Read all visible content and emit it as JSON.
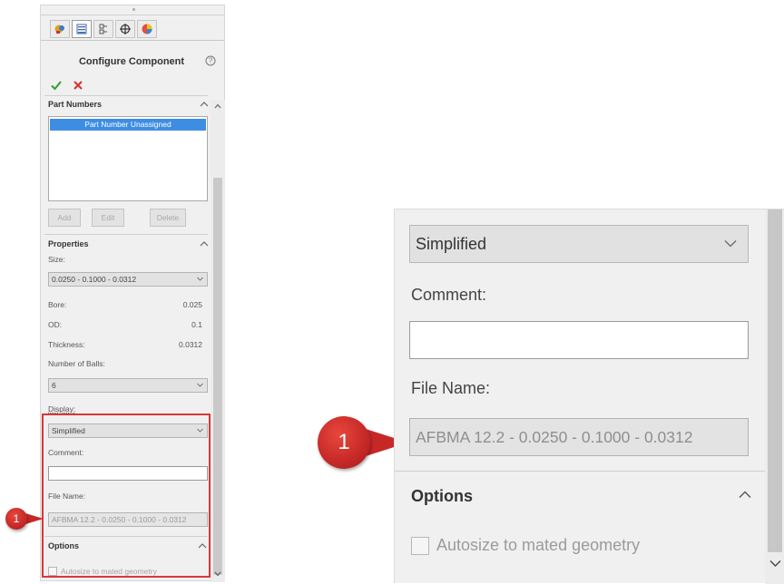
{
  "left_panel": {
    "tabs": [
      {
        "name": "feature-manager-tab",
        "icon": "feature-manager-icon"
      },
      {
        "name": "property-manager-tab",
        "icon": "property-manager-icon"
      },
      {
        "name": "configuration-manager-tab",
        "icon": "configuration-manager-icon"
      },
      {
        "name": "dimxpert-manager-tab",
        "icon": "crosshair-icon"
      },
      {
        "name": "display-manager-tab",
        "icon": "display-manager-icon"
      }
    ],
    "title": "Configure Component",
    "part_numbers": {
      "heading": "Part Numbers",
      "items": [
        "Part Number Unassigned"
      ],
      "buttons": {
        "add": "Add",
        "edit": "Edit",
        "delete": "Delete"
      }
    },
    "properties": {
      "heading": "Properties",
      "size_label": "Size:",
      "size_value": "0.0250 - 0.1000 - 0.0312",
      "bore_label": "Bore:",
      "bore_value": "0.025",
      "od_label": "OD:",
      "od_value": "0.1",
      "thickness_label": "Thickness:",
      "thickness_value": "0.0312",
      "balls_label": "Number of Balls:",
      "balls_value": "6",
      "display_label": "Display:",
      "display_value": "Simplified",
      "comment_label": "Comment:",
      "comment_value": "",
      "filename_label": "File Name:",
      "filename_value": "AFBMA 12.2 - 0.0250 - 0.1000 - 0.0312"
    },
    "options": {
      "heading": "Options",
      "autosize_label": "Autosize to mated geometry",
      "autosize_checked": false
    }
  },
  "callouts": {
    "left_badge": "1",
    "right_badge": "1"
  },
  "right_panel": {
    "display_value": "Simplified",
    "comment_label": "Comment:",
    "comment_value": "",
    "filename_label": "File Name:",
    "filename_value": "AFBMA 12.2 - 0.0250 - 0.1000 - 0.0312",
    "options_heading": "Options",
    "autosize_label": "Autosize to mated geometry",
    "autosize_checked": false
  },
  "colors": {
    "accent_selection": "#3d8ee3",
    "callout_red": "#d8373c",
    "ok_green": "#2e9e3a",
    "cancel_red": "#d9302c",
    "panel_bg": "#f0f0f0"
  }
}
